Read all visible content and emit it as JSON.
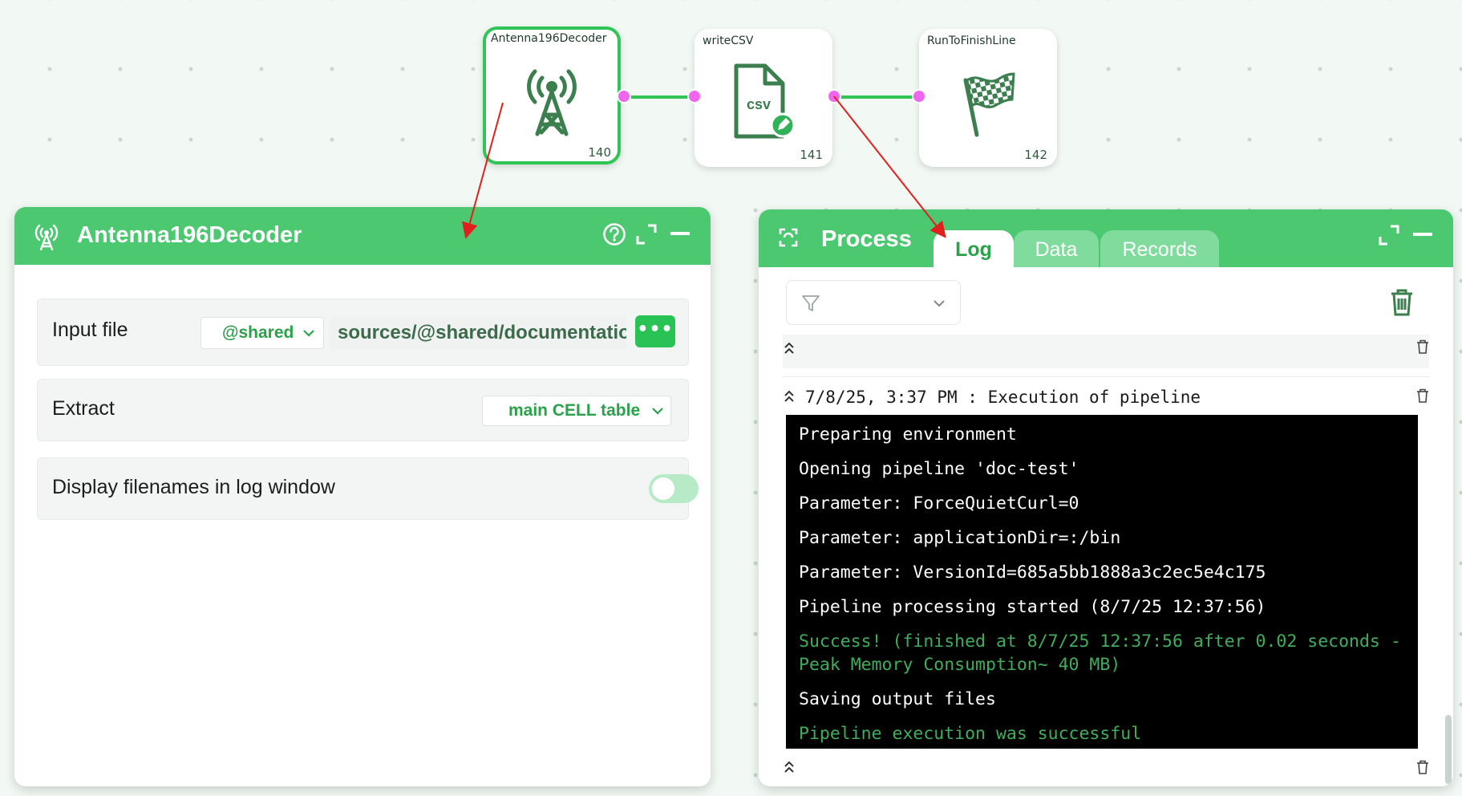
{
  "colors": {
    "accent_green": "#4cc970",
    "selected_border": "#31c457",
    "port_magenta": "#ee66ee",
    "annotation_red": "#e0201c",
    "console_bg": "#000000",
    "console_success": "#3fae5c"
  },
  "nodes": [
    {
      "title": "Antenna196Decoder",
      "number": "140",
      "icon": "antenna-tower-icon",
      "selected": true
    },
    {
      "title": "writeCSV",
      "number": "141",
      "icon": "csv-file-edit-icon",
      "icon_text": "csv",
      "selected": false
    },
    {
      "title": "RunToFinishLine",
      "number": "142",
      "icon": "checkered-flag-icon",
      "selected": false
    }
  ],
  "settings_panel": {
    "title": "Antenna196Decoder",
    "icon": "antenna-icon",
    "buttons": [
      "help-icon",
      "maximize-icon",
      "minimize-icon"
    ],
    "rows": [
      {
        "label": "Input file",
        "scope": "@shared",
        "path": "sources/@shared/documentation/",
        "browse_label": "•••"
      },
      {
        "label": "Extract",
        "value": "main CELL table"
      },
      {
        "label": "Display filenames in log window",
        "toggle_on": false
      }
    ]
  },
  "process_panel": {
    "title": "Process",
    "icon": "process-icon",
    "tabs": [
      {
        "label": "Log",
        "active": true
      },
      {
        "label": "Data",
        "active": false
      },
      {
        "label": "Records",
        "active": false
      }
    ],
    "filter_icon": "filter-icon",
    "log": {
      "header": "7/8/25, 3:37 PM : Execution of pipeline",
      "lines": [
        {
          "text": "Preparing environment",
          "status": "normal"
        },
        {
          "text": "Opening pipeline 'doc-test'",
          "status": "normal"
        },
        {
          "text": "Parameter: ForceQuietCurl=0",
          "status": "normal"
        },
        {
          "text": "Parameter: applicationDir=:/bin",
          "status": "normal"
        },
        {
          "text": "Parameter: VersionId=685a5bb1888a3c2ec5e4c175",
          "status": "normal"
        },
        {
          "text": "Pipeline processing started (8/7/25 12:37:56)",
          "status": "normal"
        },
        {
          "text": "Success! (finished at 8/7/25 12:37:56 after 0.02 seconds - Peak Memory Consumption~ 40 MB)",
          "status": "success"
        },
        {
          "text": "Saving output files",
          "status": "normal"
        },
        {
          "text": "Pipeline execution was successful",
          "status": "success"
        }
      ]
    }
  }
}
